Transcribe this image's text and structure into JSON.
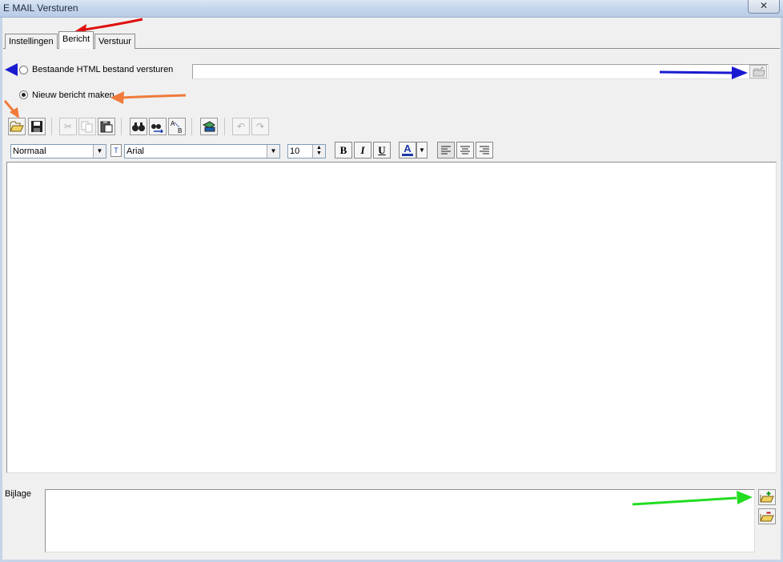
{
  "window": {
    "title": "E MAIL Versturen",
    "close_symbol": "✕"
  },
  "tabs": [
    {
      "label": "Instellingen"
    },
    {
      "label": "Bericht"
    },
    {
      "label": "Verstuur"
    }
  ],
  "source": {
    "existing_label": "Bestaande HTML bestand versturen",
    "new_label": "Nieuw bericht maken",
    "selected": "new",
    "path_value": ""
  },
  "format": {
    "style": "Normaal",
    "font": "Arial",
    "size": "10",
    "bold": "B",
    "italic": "I",
    "underline": "U",
    "font_color_glyph": "A",
    "font_color": "#1f3aa8"
  },
  "attachments": {
    "label": "Bijlage",
    "items": []
  },
  "annotations": {
    "red": "#e01010",
    "blue": "#1a1ad0",
    "orange": "#f07a3a",
    "green": "#22dd22"
  },
  "icons": [
    "open-folder-icon",
    "save-icon",
    "cut-icon",
    "copy-icon",
    "paste-icon",
    "find-icon",
    "find-next-icon",
    "replace-icon",
    "insert-image-icon",
    "undo-icon",
    "redo-icon",
    "align-left-icon",
    "align-center-icon",
    "align-right-icon",
    "add-attachment-icon",
    "remove-attachment-icon",
    "browse-folder-icon"
  ]
}
